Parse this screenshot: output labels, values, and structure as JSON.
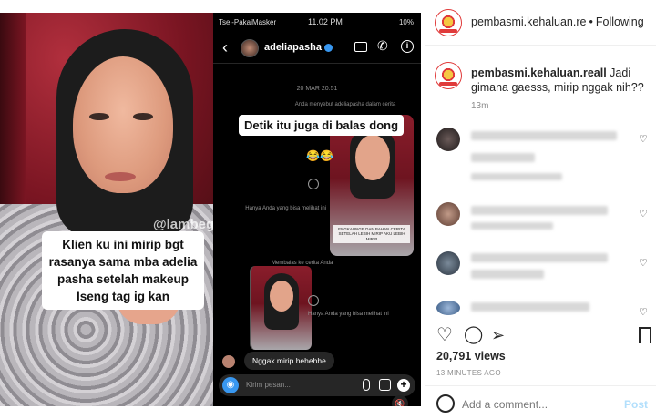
{
  "media": {
    "left_photo": {
      "watermark": "@lambegosiip",
      "caption": "Klien ku ini mirip bgt rasanya sama mba adelia pasha setelah makeup Iseng tag ig kan"
    },
    "phone": {
      "carrier": "Tsel-PakaiMasker",
      "time": "11.02 PM",
      "battery": "10%",
      "dm_username": "adeliapasha",
      "date_label": "20 MAR 20.51",
      "mention_text": "Anda menyebut adeliapasha dalam cerita",
      "story_banner": "ENGKAUNGE DAN BAHAN CERITA SETELAH LEBIH MIRIP AKU LEBIH MIRIP",
      "overlay_line1": "Detik itu juga di balas dong",
      "overlay_line2": "",
      "overlay_emoji": "😂😂",
      "only_you_1": "Hanya Anda yang bisa melihat ini",
      "reply_story_label": "Membalas ke cerita Anda",
      "only_you_2": "Hanya Anda yang bisa melihat ini",
      "reply_bubble": "Nggak mirip hehehhe",
      "composer_placeholder": "Kirim pesan..."
    }
  },
  "post_panel": {
    "header": {
      "username": "pembasmi.kehaluan.re",
      "separator": "•",
      "follow_status": "Following"
    },
    "caption": {
      "username": "pembasmi.kehaluan.reall",
      "text": "Jadi gimana gaesss, mirip nggak nih??",
      "time": "13m"
    },
    "actions": {
      "like_icon": "heart-icon",
      "comment_icon": "comment-icon",
      "share_icon": "share-icon",
      "save_icon": "bookmark-icon"
    },
    "views": "20,791 views",
    "posted_ago": "13 MINUTES AGO",
    "add_comment_placeholder": "Add a comment...",
    "post_label": "Post"
  },
  "colors": {
    "link_blue": "#3897f0",
    "post_disabled": "#b2dffc",
    "muted_text": "#8e8e8e",
    "brand_red": "#e03a3a"
  }
}
